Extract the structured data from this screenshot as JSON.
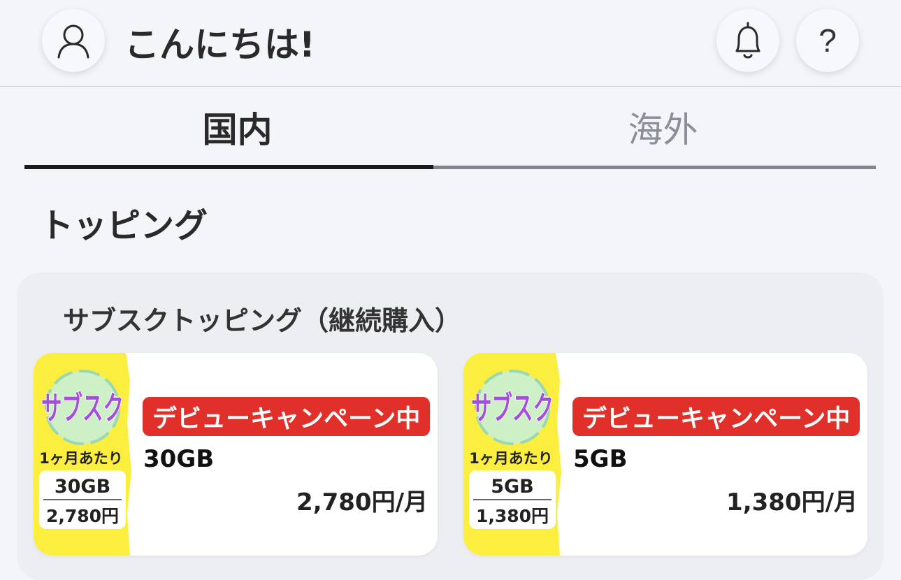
{
  "header": {
    "greeting": "こんにちは!",
    "avatar_icon": "user-icon",
    "bell_icon": "bell-icon",
    "help_icon": "help-icon",
    "help_label": "?"
  },
  "tabs": [
    {
      "label": "国内",
      "active": true
    },
    {
      "label": "海外",
      "active": false
    }
  ],
  "section": {
    "title": "トッピング"
  },
  "panel": {
    "title": "サブスクトッピング（継続購入）"
  },
  "cards": [
    {
      "badge": {
        "logo": "サブスク",
        "caption": "1ヶ月あたり",
        "data": "30GB",
        "price": "2,780円"
      },
      "campaign": "デビューキャンペーン中",
      "plan": "30GB",
      "price": "2,780円/月"
    },
    {
      "badge": {
        "logo": "サブスク",
        "caption": "1ヶ月あたり",
        "data": "5GB",
        "price": "1,380円"
      },
      "campaign": "デビューキャンペーン中",
      "plan": "5GB",
      "price": "1,380円/月"
    }
  ],
  "colors": {
    "campaign_red": "#e1302a",
    "badge_yellow": "#fcee3f",
    "logo_purple": "#a44ee0"
  }
}
